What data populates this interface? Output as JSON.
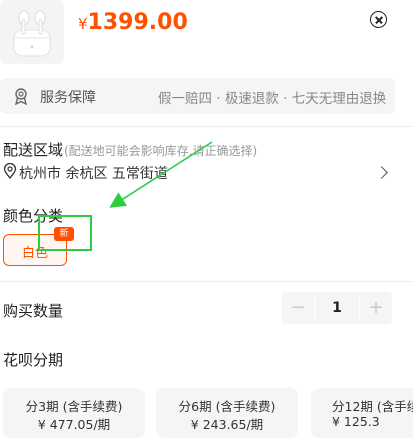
{
  "product": {
    "currency_symbol": "¥",
    "price": "1399.00"
  },
  "service": {
    "label": "服务保障",
    "description": "假一赔四 · 极速退款 · 七天无理由退换"
  },
  "delivery": {
    "title": "配送区域",
    "hint": "(配送地可能会影响库存,请正确选择)",
    "address": "杭州市 余杭区 五常街道"
  },
  "color": {
    "title": "颜色分类",
    "options": [
      {
        "label": "白色",
        "badge": "新",
        "selected": true
      }
    ]
  },
  "quantity": {
    "title": "购买数量",
    "minus": "−",
    "value": "1",
    "plus": "+"
  },
  "installment": {
    "title": "花呗分期",
    "plans": [
      {
        "term": "分3期 (含手续费)",
        "amount": "¥ 477.05/期"
      },
      {
        "term": "分6期 (含手续费)",
        "amount": "¥ 243.65/期"
      },
      {
        "term": "分12期 (含手续费)",
        "amount": "¥ 125.3"
      }
    ]
  },
  "colors": {
    "accent": "#ff5000",
    "annotation": "#2ecc40"
  }
}
